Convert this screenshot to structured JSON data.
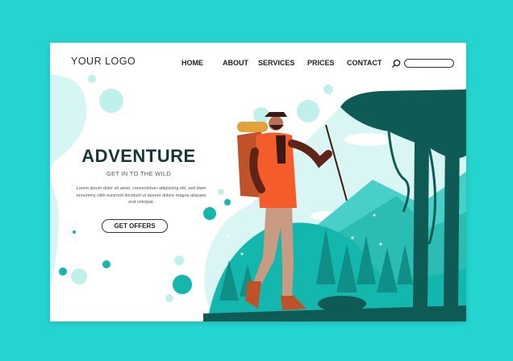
{
  "header": {
    "logo": "YOUR LOGO",
    "nav": [
      "HOME",
      "ABOUT",
      "SERVICES",
      "PRICES",
      "CONTACT"
    ]
  },
  "hero": {
    "title": "ADVENTURE",
    "subtitle": "GET IN TO THE WILD",
    "body": "Lorem ipsum dolor sit amet, consectetuer adipiscing elit, sed diam nonummy nibh euismod tincidunt ut laoreet dolore magna aliquam erat volutpat.",
    "cta": "GET OFFERS"
  },
  "colors": {
    "background": "#24d4cf",
    "teal": "#14b7ad",
    "dark_teal": "#0e5b55",
    "orange": "#f45d2a"
  }
}
